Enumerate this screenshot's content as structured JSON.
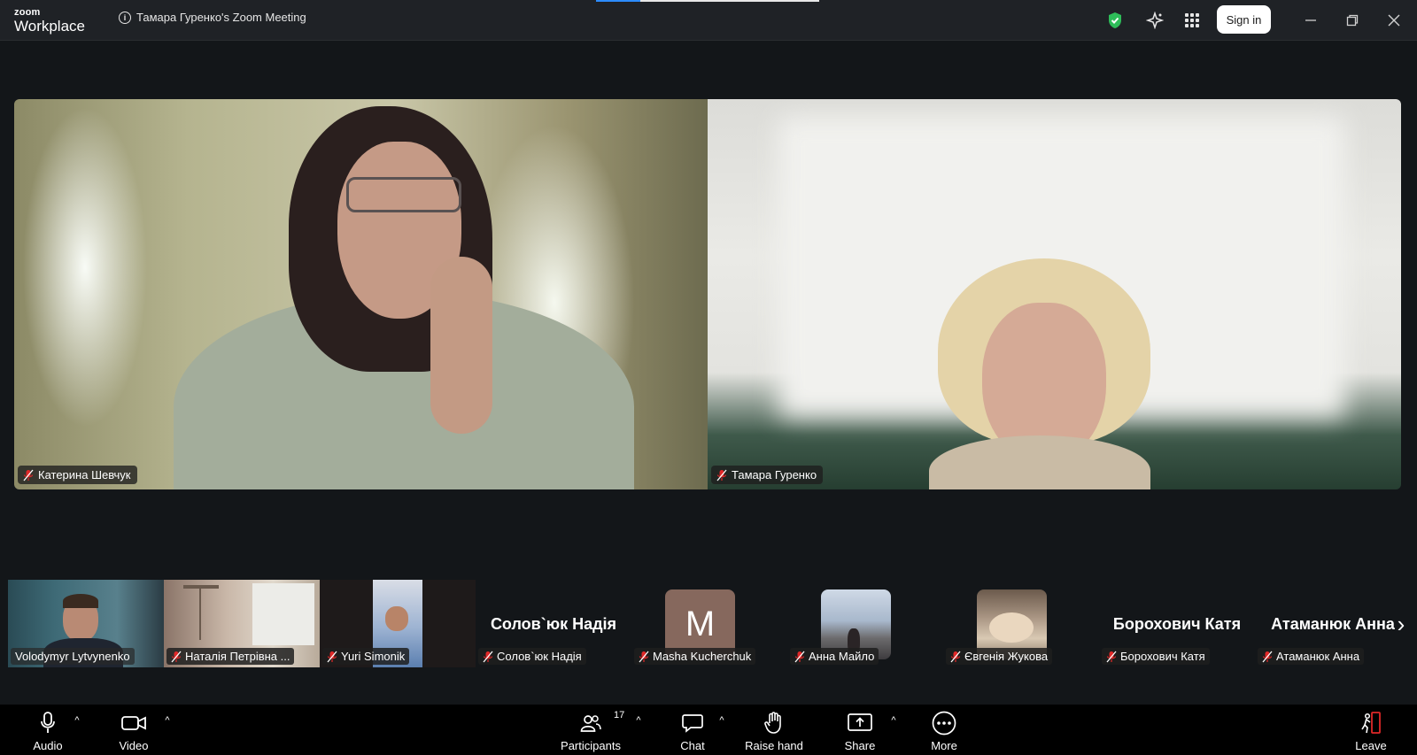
{
  "titlebar": {
    "logo_small": "zoom",
    "logo_big": "Workplace",
    "meeting_title": "Тамара Гуренко's Zoom Meeting",
    "signin_label": "Sign in",
    "security_color": "#2ebd59"
  },
  "main_videos": [
    {
      "name": "Катерина Шевчук"
    },
    {
      "name": "Тамара Гуренко"
    }
  ],
  "thumbnails": [
    {
      "name": "Volodymyr Lytvynenko",
      "type": "video"
    },
    {
      "name": "Наталія Петрівна ...",
      "type": "video"
    },
    {
      "name": "Yuri Simonik",
      "type": "video"
    },
    {
      "name": "Солов`юк Надія",
      "display": "Солов`юк Надія",
      "type": "name"
    },
    {
      "name": "Masha Kucherchuk",
      "initial": "M",
      "type": "initial"
    },
    {
      "name": "Анна Майло",
      "type": "photo"
    },
    {
      "name": "Євгенія Жукова",
      "type": "photo"
    },
    {
      "name": "Борохович Катя",
      "display": "Борохович Катя",
      "type": "name"
    },
    {
      "name": "Атаманюк Анна",
      "display": "Атаманюк Анна",
      "type": "name"
    }
  ],
  "toolbar": {
    "audio": "Audio",
    "video": "Video",
    "participants": "Participants",
    "participants_count": "17",
    "chat": "Chat",
    "raise_hand": "Raise hand",
    "share": "Share",
    "more": "More",
    "leave": "Leave"
  }
}
